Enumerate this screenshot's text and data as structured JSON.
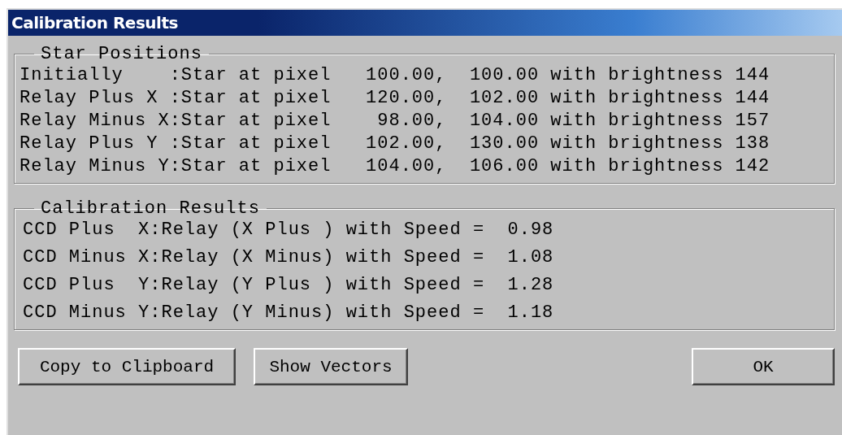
{
  "window": {
    "title": "Calibration Results"
  },
  "star_positions": {
    "legend": "Star Positions",
    "lines": [
      "Initially    :Star at pixel   100.00,  100.00 with brightness 144",
      "Relay Plus X :Star at pixel   120.00,  102.00 with brightness 144",
      "Relay Minus X:Star at pixel    98.00,  104.00 with brightness 157",
      "Relay Plus Y :Star at pixel   102.00,  130.00 with brightness 138",
      "Relay Minus Y:Star at pixel   104.00,  106.00 with brightness 142"
    ]
  },
  "calibration_results": {
    "legend": "Calibration Results",
    "lines": [
      "CCD Plus  X:Relay (X Plus ) with Speed =  0.98",
      "CCD Minus X:Relay (X Minus) with Speed =  1.08",
      "CCD Plus  Y:Relay (Y Plus ) with Speed =  1.28",
      "CCD Minus Y:Relay (Y Minus) with Speed =  1.18"
    ]
  },
  "buttons": [
    "Copy to Clipboard",
    "Show Vectors",
    "OK"
  ]
}
